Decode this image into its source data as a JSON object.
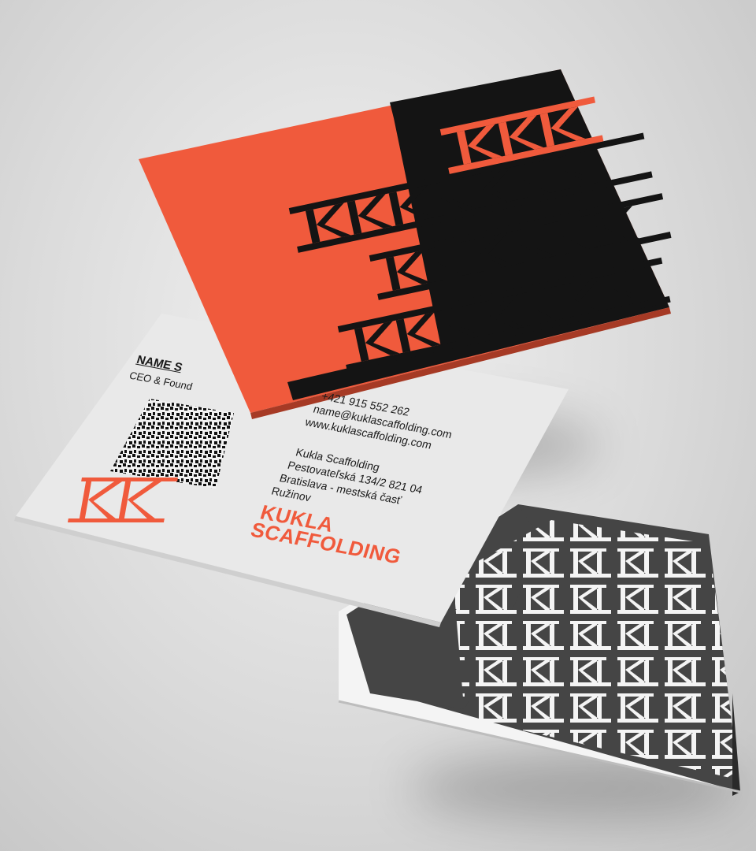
{
  "scene": "business card mockup",
  "brand": {
    "line1": "KUKLA",
    "line2": "SCAFFOLDING",
    "accent_color": "#f05a3c",
    "dark_color": "#141414",
    "logo_icon": "kk-scaffold-logo-icon"
  },
  "back_card": {
    "name": "NAME S",
    "title": "CEO & Found",
    "qr_icon": "qr-code-icon",
    "phone": "+421 915 552 262",
    "email": "name@kuklascaffolding.com",
    "website": "www.kuklascaffolding.com",
    "company": "Kukla Scaffolding",
    "street": "Pestovateľská 134/2 821 04",
    "city": "Bratislava - mestská časť",
    "district": "Ružinov"
  }
}
